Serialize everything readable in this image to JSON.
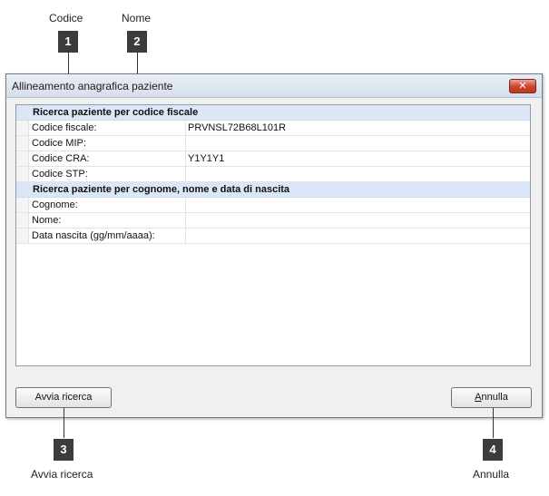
{
  "callouts": [
    {
      "number": "1",
      "label": "Codice"
    },
    {
      "number": "2",
      "label": "Nome"
    },
    {
      "number": "3",
      "label": "Avvia ricerca"
    },
    {
      "number": "4",
      "label": "Annulla"
    }
  ],
  "window": {
    "title": "Allineamento anagrafica paziente",
    "close_glyph": "✕"
  },
  "grid": {
    "section1": {
      "header": "Ricerca paziente per codice fiscale",
      "rows": [
        {
          "label": "Codice fiscale:",
          "value": "PRVNSL72B68L101R"
        },
        {
          "label": "Codice MIP:",
          "value": ""
        },
        {
          "label": "Codice CRA:",
          "value": "Y1Y1Y1"
        },
        {
          "label": "Codice STP:",
          "value": ""
        }
      ]
    },
    "section2": {
      "header": "Ricerca paziente per cognome, nome e data di nascita",
      "rows": [
        {
          "label": "Cognome:",
          "value": ""
        },
        {
          "label": "Nome:",
          "value": ""
        },
        {
          "label": "Data nascita (gg/mm/aaaa):",
          "value": ""
        }
      ]
    }
  },
  "buttons": {
    "search_label": "Avvia ricerca",
    "cancel_label_first": "A",
    "cancel_label_rest": "nnulla"
  }
}
